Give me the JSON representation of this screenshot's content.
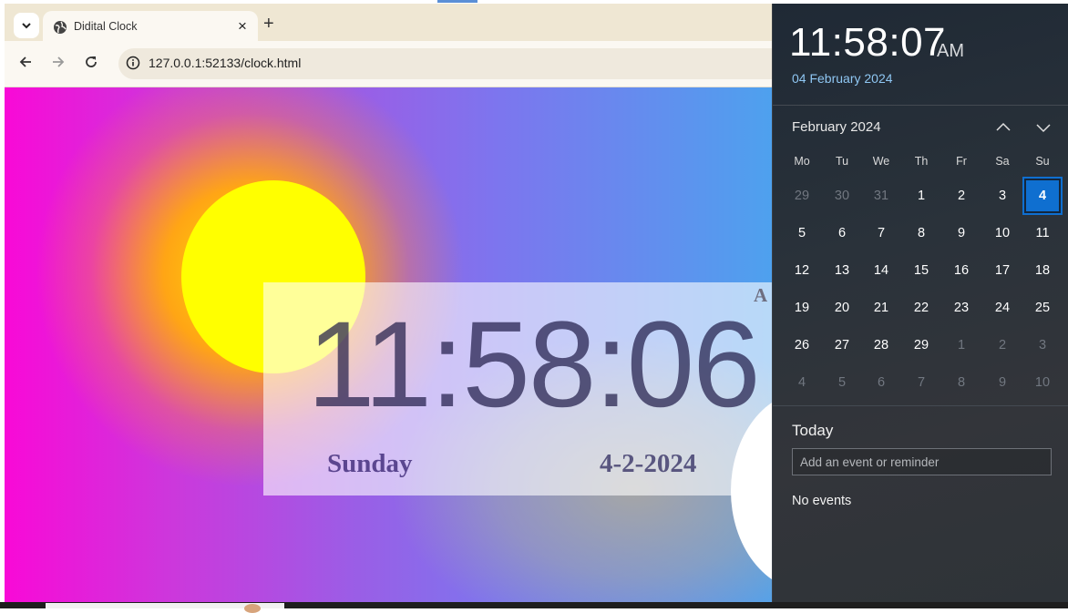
{
  "browser": {
    "tab_title": "Didital Clock",
    "tab_close": "×",
    "new_tab": "+",
    "url": "127.0.0.1:52133/clock.html"
  },
  "page": {
    "ampm": "A",
    "time": "11:58:06",
    "day": "Sunday",
    "date": "4-2-2024"
  },
  "flyout": {
    "time": "11:58:07",
    "ampm": "AM",
    "date": "04 February 2024",
    "month_label": "February 2024",
    "weekdays": [
      "Mo",
      "Tu",
      "We",
      "Th",
      "Fr",
      "Sa",
      "Su"
    ],
    "weeks": [
      [
        "29",
        "30",
        "31",
        "1",
        "2",
        "3",
        "4"
      ],
      [
        "5",
        "6",
        "7",
        "8",
        "9",
        "10",
        "11"
      ],
      [
        "12",
        "13",
        "14",
        "15",
        "16",
        "17",
        "18"
      ],
      [
        "19",
        "20",
        "21",
        "22",
        "23",
        "24",
        "25"
      ],
      [
        "26",
        "27",
        "28",
        "29",
        "1",
        "2",
        "3"
      ],
      [
        "4",
        "5",
        "6",
        "7",
        "8",
        "9",
        "10"
      ]
    ],
    "dimmed": [
      [
        true,
        true,
        true,
        false,
        false,
        false,
        false
      ],
      [
        false,
        false,
        false,
        false,
        false,
        false,
        false
      ],
      [
        false,
        false,
        false,
        false,
        false,
        false,
        false
      ],
      [
        false,
        false,
        false,
        false,
        false,
        false,
        false
      ],
      [
        false,
        false,
        false,
        false,
        true,
        true,
        true
      ],
      [
        true,
        true,
        true,
        true,
        true,
        true,
        true
      ]
    ],
    "selected": {
      "week": 0,
      "day": 6
    },
    "today_label": "Today",
    "event_placeholder": "Add an event or reminder",
    "no_events": "No events"
  },
  "colors": {
    "accent": "#0f6fd0",
    "flyout_date": "#8fc7f3"
  }
}
